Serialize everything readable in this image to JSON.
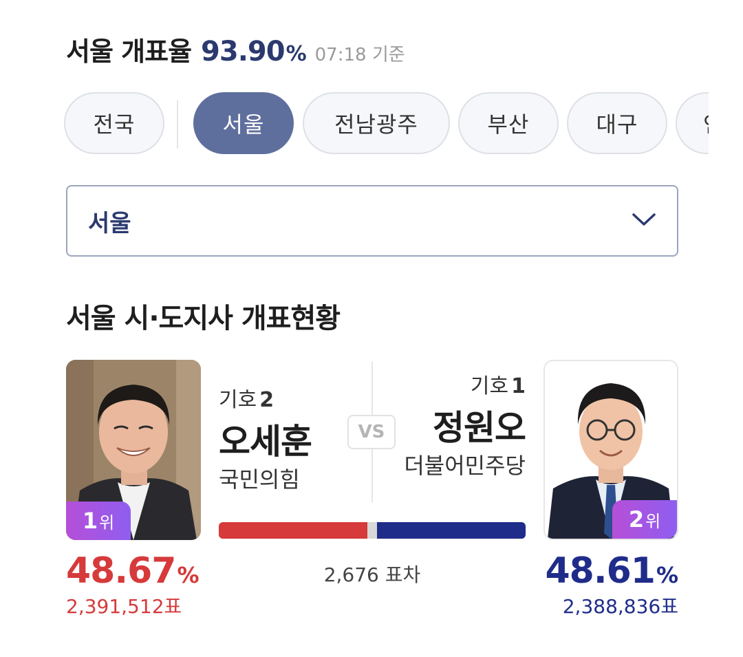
{
  "header": {
    "title": "서울 개표율",
    "rate": "93.90",
    "rate_unit": "%",
    "time": "07:18 기준"
  },
  "chips": [
    {
      "label": "전국",
      "active": false
    },
    {
      "label": "서울",
      "active": true
    },
    {
      "label": "전남광주",
      "active": false
    },
    {
      "label": "부산",
      "active": false
    },
    {
      "label": "대구",
      "active": false
    },
    {
      "label": "인",
      "active": false
    }
  ],
  "select": {
    "value": "서울",
    "icon": "chevron-down-icon"
  },
  "section_title": "서울 시·도지사 개표현황",
  "vs_label": "VS",
  "colors": {
    "leader": "#d63a3a",
    "second": "#1f2c8a",
    "accent": "#2b3a6e",
    "chip_active": "#5f6f9d",
    "badge_from": "#b64fd8",
    "badge_to": "#8f5ef0"
  },
  "candidates": {
    "left": {
      "number_label": "기호",
      "number": "2",
      "name": "오세훈",
      "party": "국민의힘",
      "rank": "1",
      "rank_unit": "위",
      "percent": "48.67",
      "percent_unit": "%",
      "votes": "2,391,512표",
      "vote_share": 48.67
    },
    "right": {
      "number_label": "기호",
      "number": "1",
      "name": "정원오",
      "party": "더불어민주당",
      "rank": "2",
      "rank_unit": "위",
      "percent": "48.61",
      "percent_unit": "%",
      "votes": "2,388,836표",
      "vote_share": 48.61
    }
  },
  "margin": "2,676 표차"
}
